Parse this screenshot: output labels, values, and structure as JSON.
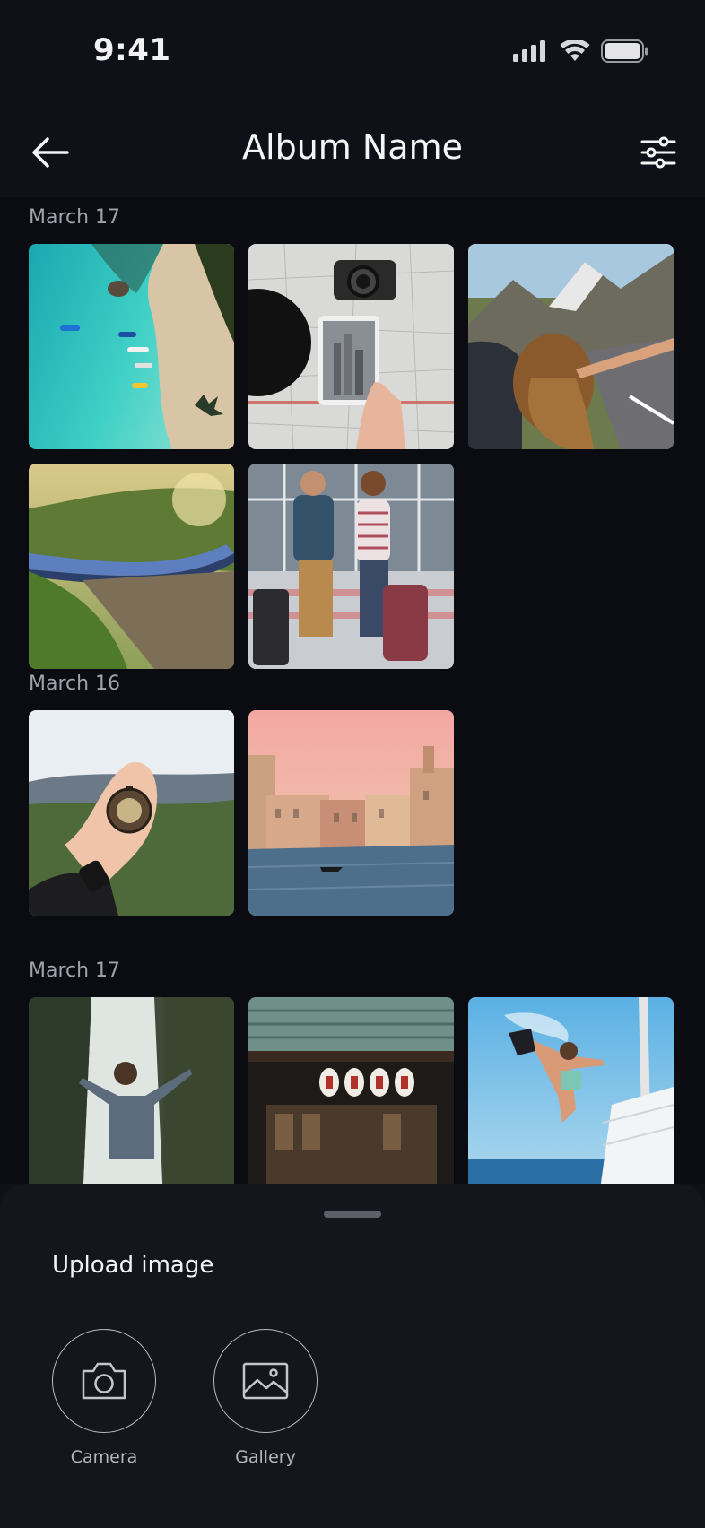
{
  "status_bar": {
    "time": "9:41"
  },
  "header": {
    "title": "Album Name"
  },
  "sections": [
    {
      "date": "March 17",
      "photos": [
        "photo-beach-aerial",
        "photo-map-tablet",
        "photo-car-window",
        "photo-train-bridge",
        "photo-travelers-luggage"
      ]
    },
    {
      "date": "March 16",
      "photos": [
        "photo-compass-hand",
        "photo-venice-canal"
      ]
    },
    {
      "date": "March 17",
      "photos": [
        "photo-waterfall-woman",
        "photo-japanese-storefront",
        "photo-sailboat-jump"
      ]
    }
  ],
  "upload_sheet": {
    "title": "Upload image",
    "actions": [
      {
        "label": "Camera",
        "icon": "camera-icon"
      },
      {
        "label": "Gallery",
        "icon": "gallery-icon"
      }
    ]
  },
  "colors": {
    "background": "#0f1118",
    "sheet": "#14161d",
    "text_secondary": "#9ea3ad"
  }
}
